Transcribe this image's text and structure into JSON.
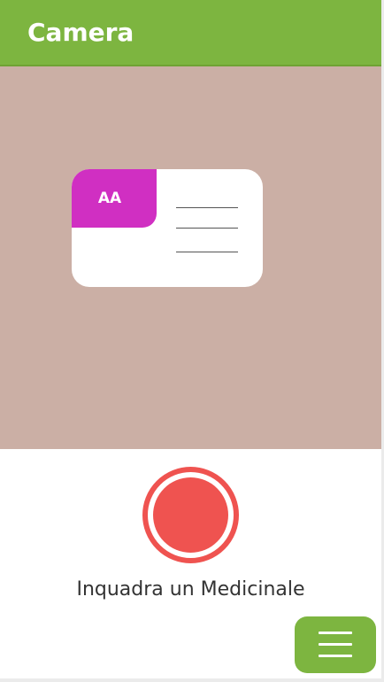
{
  "header": {
    "title": "Camera"
  },
  "viewfinder": {
    "card_tag": "AA"
  },
  "capture": {
    "instruction": "Inquadra un Medicinale"
  },
  "icons": {
    "record": "record-icon",
    "menu": "hamburger-menu-icon"
  },
  "colors": {
    "brand_green": "#7db540",
    "viewfinder_bg": "#cbafa5",
    "card_tag": "#d02fc2",
    "record_red": "#ef5350"
  }
}
